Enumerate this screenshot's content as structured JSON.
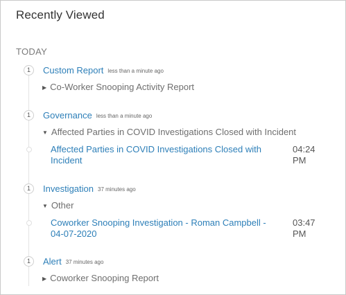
{
  "panel": {
    "title": "Recently Viewed",
    "section_label": "TODAY"
  },
  "groups": [
    {
      "index": "1",
      "category": "Custom Report",
      "time_ago": "less than a minute ago",
      "sub": "Co-Worker Snooping Activity Report",
      "sub_icon": "caret-right-icon"
    },
    {
      "index": "1",
      "category": "Governance",
      "time_ago": "less than a minute ago",
      "sub": "Affected Parties in COVID Investigations Closed with Incident",
      "sub_icon": "caret-down-icon",
      "item": {
        "line1": "Affected Parties in COVID Investigations Closed with",
        "line2": "Incident",
        "time1": "04:24",
        "time2": "PM"
      }
    },
    {
      "index": "1",
      "category": "Investigation",
      "time_ago": "37 minutes ago",
      "sub": "Other",
      "sub_icon": "caret-down-icon",
      "item": {
        "line1": "Coworker Snooping Investigation - Roman Campbell -",
        "line2": "04-07-2020",
        "time1": "03:47",
        "time2": "PM"
      }
    },
    {
      "index": "1",
      "category": "Alert",
      "time_ago": "37 minutes ago",
      "sub": "Coworker Snooping Report",
      "sub_icon": "caret-right-icon"
    }
  ],
  "colors": {
    "link": "#2d7fb8",
    "muted": "#6e6e6e",
    "border": "#c9c9c9"
  }
}
